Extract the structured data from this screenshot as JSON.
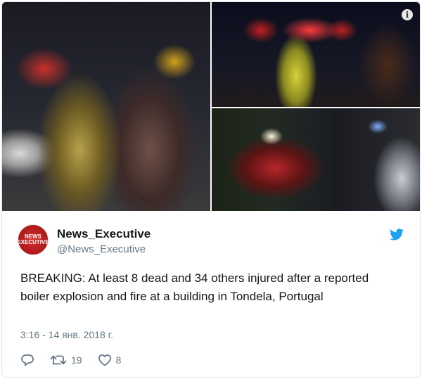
{
  "media": {
    "photos": [
      "left-photo",
      "top-right-photo",
      "bottom-right-photo"
    ]
  },
  "author": {
    "avatar_text": "NEWS EXECUTIVE",
    "display_name": "News_Executive",
    "handle": "@News_Executive"
  },
  "tweet": {
    "text": "BREAKING:  At least 8 dead and 34 others injured after a reported boiler explosion and fire at a building in Tondela, Portugal",
    "timestamp": "3:16 - 14 янв. 2018 г."
  },
  "actions": {
    "retweets": "19",
    "likes": "8"
  },
  "colors": {
    "twitter_blue": "#1da1f2",
    "secondary_text": "#657786",
    "primary_text": "#14171a"
  }
}
